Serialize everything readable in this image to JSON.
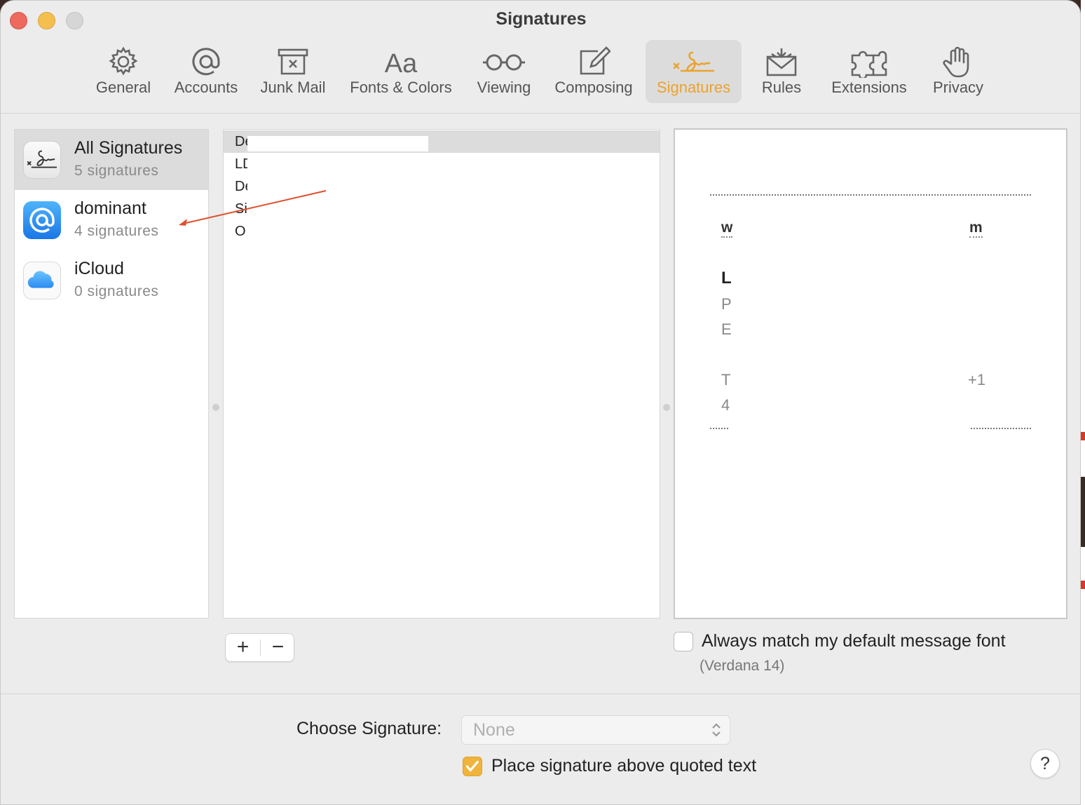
{
  "window": {
    "title": "Signatures"
  },
  "toolbar": {
    "items": [
      {
        "label": "General",
        "icon": "gear-icon"
      },
      {
        "label": "Accounts",
        "icon": "at-sign-icon"
      },
      {
        "label": "Junk Mail",
        "icon": "junk-bin-icon"
      },
      {
        "label": "Fonts & Colors",
        "icon": "font-aa-icon"
      },
      {
        "label": "Viewing",
        "icon": "glasses-icon"
      },
      {
        "label": "Composing",
        "icon": "compose-icon"
      },
      {
        "label": "Signatures",
        "icon": "signature-icon",
        "active": true
      },
      {
        "label": "Rules",
        "icon": "rules-envelope-icon"
      },
      {
        "label": "Extensions",
        "icon": "puzzle-icon"
      },
      {
        "label": "Privacy",
        "icon": "hand-icon"
      }
    ],
    "active_color": "#eba32c"
  },
  "accounts": [
    {
      "name": "All Signatures",
      "count": "5 signatures",
      "icon": "signature-icon",
      "selected": true
    },
    {
      "name": "dominant",
      "count": "4 signatures",
      "icon": "at-sign-icon"
    },
    {
      "name": "iCloud",
      "count": "0 signatures",
      "icon": "icloud-icon"
    }
  ],
  "signatures": {
    "rows": [
      "De",
      "LD",
      "De",
      "Si",
      "O"
    ]
  },
  "preview": {
    "line1": "w",
    "line1_end": "m",
    "name_initial": "L",
    "line_p": "P",
    "line_e": "E",
    "line_t": "T",
    "line_t_end": "+1",
    "line_4": "4"
  },
  "buttons": {
    "add": "+",
    "remove": "−"
  },
  "options": {
    "match_font_label": "Always match my default message font",
    "match_font_sub": "(Verdana 14)",
    "choose_signature_label": "Choose Signature:",
    "choose_signature_value": "None",
    "place_above_label": "Place signature above quoted text",
    "help": "?"
  },
  "annotation_color": "#e0502e"
}
